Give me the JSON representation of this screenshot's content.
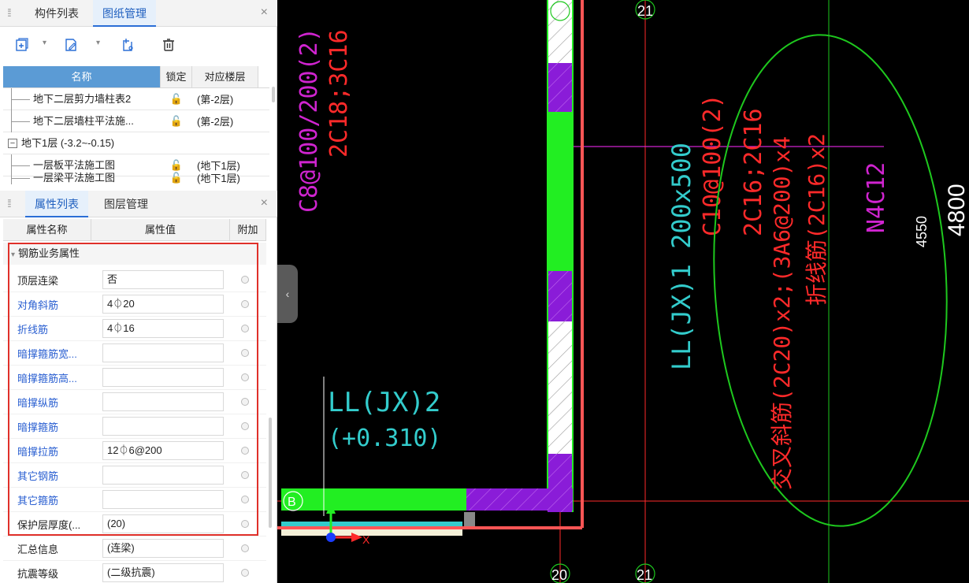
{
  "top_panel": {
    "tabs": [
      {
        "label": "构件列表",
        "active": false
      },
      {
        "label": "图纸管理",
        "active": true
      }
    ],
    "close_glyph": "×",
    "toolbar": [
      {
        "icon": "add-drawing-icon"
      },
      {
        "icon": "edit-drawing-icon"
      },
      {
        "icon": "split-drawing-icon"
      },
      {
        "icon": "delete-icon"
      }
    ],
    "table": {
      "headers": {
        "name": "名称",
        "lock": "锁定",
        "floor": "对应楼层"
      },
      "rows": [
        {
          "type": "item",
          "name": "地下二层剪力墙柱表2",
          "lock": "🔓",
          "floor": "(第-2层)"
        },
        {
          "type": "item",
          "name": "地下二层墙柱平法施...",
          "lock": "🔓",
          "floor": "(第-2层)"
        },
        {
          "type": "group",
          "expander": "−",
          "name": "地下1层 (-3.2~-0.15)"
        },
        {
          "type": "item",
          "name": "一层板平法施工图",
          "lock": "🔓",
          "floor": "(地下1层)"
        },
        {
          "type": "item",
          "name": "一层梁平法施工图",
          "lock": "🔓",
          "floor": "(地下1层)"
        }
      ]
    }
  },
  "bottom_panel": {
    "tabs": [
      {
        "label": "属性列表",
        "active": true
      },
      {
        "label": "图层管理",
        "active": false
      }
    ],
    "close_glyph": "×",
    "headers": {
      "name": "属性名称",
      "value": "属性值",
      "add": "附加"
    },
    "group_label": "钢筋业务属性",
    "properties": [
      {
        "name": "顶层连梁",
        "value": "否",
        "blue": false
      },
      {
        "name": "对角斜筋",
        "value": "4⏀20",
        "blue": true
      },
      {
        "name": "折线筋",
        "value": "4⏀16",
        "blue": true
      },
      {
        "name": "暗撑箍筋宽...",
        "value": "",
        "blue": true
      },
      {
        "name": "暗撑箍筋高...",
        "value": "",
        "blue": true
      },
      {
        "name": "暗撑纵筋",
        "value": "",
        "blue": true
      },
      {
        "name": "暗撑箍筋",
        "value": "",
        "blue": true
      },
      {
        "name": "暗撑拉筋",
        "value": "12⏀6@200",
        "blue": true
      },
      {
        "name": "其它钢筋",
        "value": "",
        "blue": true
      },
      {
        "name": "其它箍筋",
        "value": "",
        "blue": true
      },
      {
        "name": "保护层厚度(...",
        "value": "(20)",
        "blue": false
      },
      {
        "name": "汇总信息",
        "value": "(连梁)",
        "blue": false
      },
      {
        "name": "抗震等级",
        "value": "(二级抗震)",
        "blue": false
      }
    ]
  },
  "cad": {
    "colors": {
      "background": "#000000",
      "magenta": "#d024d0",
      "red": "#ff2a2a",
      "green": "#1ec81e",
      "bright_green": "#22ee22",
      "cyan": "#33cccc",
      "white": "#ffffff",
      "purple_fill": "#8a1cd8",
      "highlight_red": "#e0302a"
    },
    "axis_labels": {
      "top_21": "21",
      "bottom_20": "20",
      "bottom_21": "21",
      "left_B": "B"
    },
    "texts": {
      "magenta_rebar": "C8@100/200(2)",
      "red_rebar": "2C18;3C16",
      "ll_jx2": "LL(JX)2",
      "ll_jx2_elev": "(+0.310)",
      "ll_jx1": "LL(JX)1 200x500",
      "red_c10": "C10@100(2)",
      "red_2c16": "2C16;2C16",
      "red_diag_main": "交叉斜筋(2C20)x2;(3A6@200)x4",
      "red_bent": "折线筋(2C16)x2",
      "magenta_n4c12": "N4C12",
      "dim_4550": "4550",
      "dim_4800": "4800",
      "ucs_x": "X"
    }
  },
  "collapse_glyph": "‹"
}
